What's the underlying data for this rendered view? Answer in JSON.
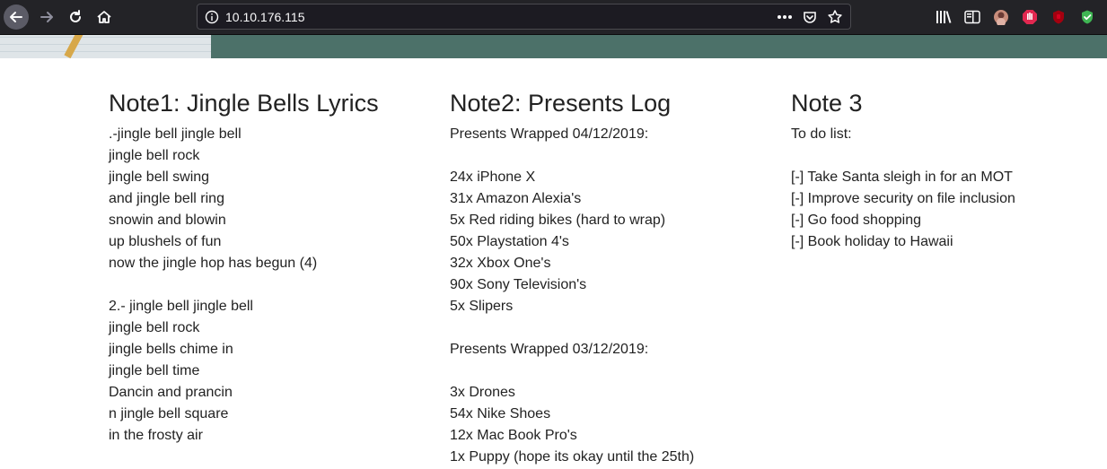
{
  "browser": {
    "url": "10.10.176.115",
    "icons": {
      "back": "back-arrow-icon",
      "forward": "forward-arrow-icon",
      "reload": "reload-icon",
      "home": "home-icon",
      "info": "info-icon",
      "page_actions": "more-dots-icon",
      "pocket": "pocket-icon",
      "bookmark": "star-icon",
      "library": "library-icon",
      "sidebar": "sidebar-icon",
      "avatar": "account-avatar-icon",
      "addon_red": "stop-hand-icon",
      "addon_red2": "shield-icon",
      "addon_green": "green-shield-icon"
    }
  },
  "notes": [
    {
      "title": "Note1: Jingle Bells Lyrics",
      "lines": [
        ".-jingle bell jingle bell",
        "jingle bell rock",
        "jingle bell swing",
        "and jingle bell ring",
        "snowin and blowin",
        "up blushels of fun",
        "now the jingle hop has begun (4)",
        "",
        "2.- jingle bell jingle bell",
        "jingle bell rock",
        "jingle bells chime in",
        "jingle bell time",
        "Dancin and prancin",
        "n jingle bell square",
        "in the frosty air"
      ]
    },
    {
      "title": "Note2: Presents Log",
      "lines": [
        "Presents Wrapped 04/12/2019:",
        "",
        "24x iPhone X",
        "31x Amazon Alexia's",
        "5x Red riding bikes (hard to wrap)",
        "50x Playstation 4's",
        "32x Xbox One's",
        "90x Sony Television's",
        "5x Slipers",
        "",
        "Presents Wrapped 03/12/2019:",
        "",
        "3x Drones",
        "54x Nike Shoes",
        "12x Mac Book Pro's",
        "1x Puppy (hope its okay until the 25th)"
      ]
    },
    {
      "title": "Note 3",
      "lines": [
        "To do list:",
        "",
        "[-] Take Santa sleigh in for an MOT",
        "[-] Improve security on file inclusion",
        "[-] Go food shopping",
        "[-] Book holiday to Hawaii"
      ]
    }
  ]
}
